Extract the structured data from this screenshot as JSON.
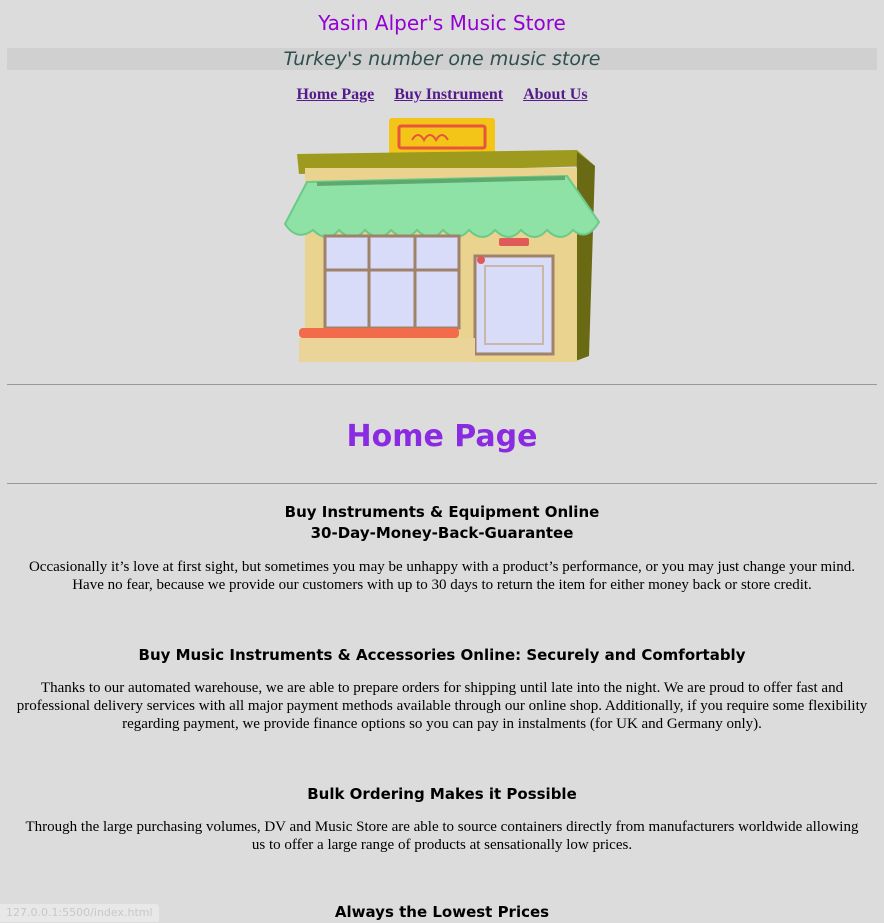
{
  "header": {
    "title": "Yasin Alper's Music Store",
    "tagline": "Turkey's number one music store"
  },
  "nav": {
    "items": [
      "Home Page",
      "Buy Instrument",
      "About Us"
    ]
  },
  "hero": {
    "alt": "store-front-illustration"
  },
  "main": {
    "heading": "Home Page",
    "sections": [
      {
        "title": "Buy Instruments & Equipment Online",
        "subtitle": "30-Day-Money-Back-Guarantee",
        "body": "Occasionally it’s love at first sight, but sometimes you may be unhappy with a product’s performance, or you may just change your mind. Have no fear, because we provide our customers with up to 30 days to return the item for either money back or store credit."
      },
      {
        "title": "Buy Music Instruments & Accessories Online: Securely and Comfortably",
        "body": "Thanks to our automated warehouse, we are able to prepare orders for shipping until late into the night. We are proud to offer fast and professional delivery services with all major payment methods available through our online shop. Additionally, if you require some flexibility regarding payment, we provide finance options so you can pay in instalments (for UK and Germany only)."
      },
      {
        "title": "Bulk Ordering Makes it Possible",
        "body": "Through the large purchasing volumes, DV and Music Store are able to source containers directly from manufacturers worldwide allowing us to offer a large range of products at sensationally low prices."
      },
      {
        "title": "Always the Lowest Prices"
      }
    ]
  },
  "statusbar": {
    "url": "127.0.0.1:5500/index.html"
  }
}
